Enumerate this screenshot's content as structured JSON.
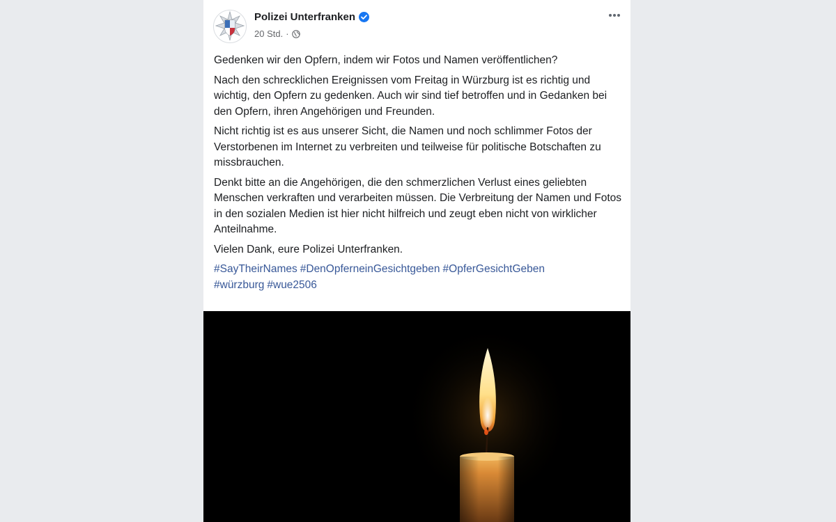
{
  "post": {
    "page_name": "Polizei Unterfranken",
    "time": "20 Std.",
    "audience_icon": "globe-icon",
    "verified_icon": "verified-badge-icon",
    "more_icon": "more-options-icon",
    "paragraphs": [
      "Gedenken wir den Opfern, indem wir Fotos und Namen veröffentlichen?",
      "Nach den schrecklichen Ereignissen vom Freitag in Würzburg ist es richtig und wichtig, den Opfern zu gedenken. Auch wir sind tief betroffen und in Gedanken bei den Opfern, ihren Angehörigen und Freunden.",
      "Nicht richtig ist es aus unserer Sicht, die Namen und noch schlimmer Fotos der Verstorbenen im Internet zu verbreiten und teilweise für politische Botschaften zu missbrauchen.",
      "Denkt bitte an die Angehörigen, die den schmerzlichen Verlust eines geliebten Menschen verkraften und verarbeiten müssen. Die Verbreitung der Namen und Fotos in den sozialen Medien ist hier nicht hilfreich und zeugt eben nicht von wirklicher Anteilnahme.",
      "Vielen Dank, eure Polizei Unterfranken."
    ],
    "hashtags": [
      "#SayTheirNames",
      "#DenOpferneinGesichtgeben",
      "#OpferGesichtGeben",
      "#würzburg",
      "#wue2506"
    ],
    "image": "candle-flame-image"
  },
  "colors": {
    "link": "#385898",
    "verified": "#1877f2",
    "text": "#1c1e21",
    "meta": "#65676b"
  }
}
